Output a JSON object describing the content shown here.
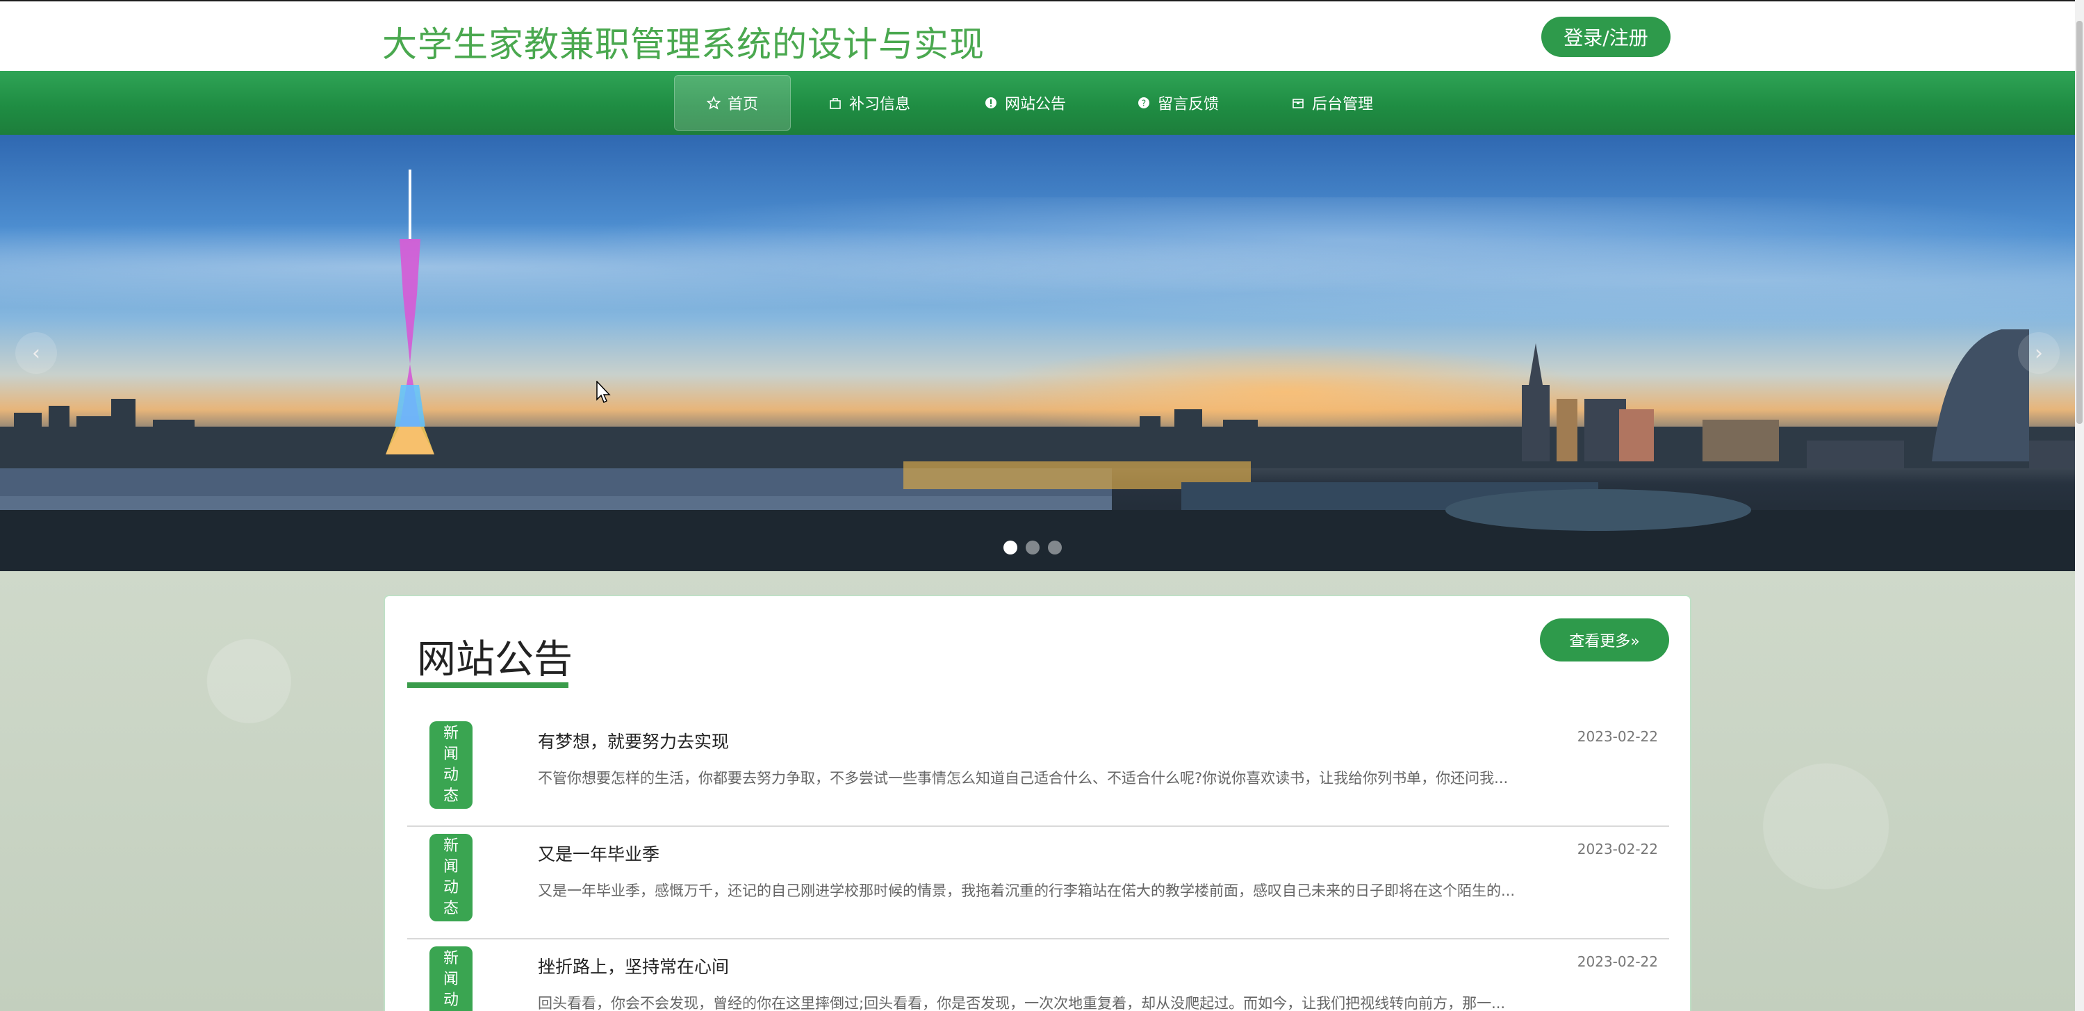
{
  "header": {
    "title": "大学生家教兼职管理系统的设计与实现",
    "login_label": "登录/注册"
  },
  "nav": {
    "items": [
      {
        "label": "首页",
        "icon": "star-icon"
      },
      {
        "label": "补习信息",
        "icon": "bag-icon"
      },
      {
        "label": "网站公告",
        "icon": "info-icon"
      },
      {
        "label": "留言反馈",
        "icon": "question-icon"
      },
      {
        "label": "后台管理",
        "icon": "box-icon"
      }
    ],
    "active_index": 0
  },
  "banner": {
    "slides": 3,
    "active_slide": 0,
    "prev_icon": "chevron-left-icon",
    "next_icon": "chevron-right-icon"
  },
  "notice": {
    "title": "网站公告",
    "more_label": "查看更多»",
    "items": [
      {
        "tag": "新闻动态",
        "title": "有梦想，就要努力去实现",
        "date": "2023-02-22",
        "desc": "不管你想要怎样的生活，你都要去努力争取，不多尝试一些事情怎么知道自己适合什么、不适合什么呢?你说你喜欢读书，让我给你列书单，你还问我..."
      },
      {
        "tag": "新闻动态",
        "title": "又是一年毕业季",
        "date": "2023-02-22",
        "desc": "又是一年毕业季，感慨万千，还记的自己刚进学校那时候的情景，我拖着沉重的行李箱站在偌大的教学楼前面，感叹自己未来的日子即将在这个陌生的..."
      },
      {
        "tag": "新闻动态",
        "title": "挫折路上，坚持常在心间",
        "date": "2023-02-22",
        "desc": "回头看看，你会不会发现，曾经的你在这里摔倒过;回头看看，你是否发现，一次次地重复着，却从没爬起过。而如今，让我们把视线转向前方，那一..."
      }
    ]
  },
  "colors": {
    "brand_green": "#2e9a4b",
    "title_green": "#4aa84f",
    "nav_green": "#1f8d43"
  }
}
